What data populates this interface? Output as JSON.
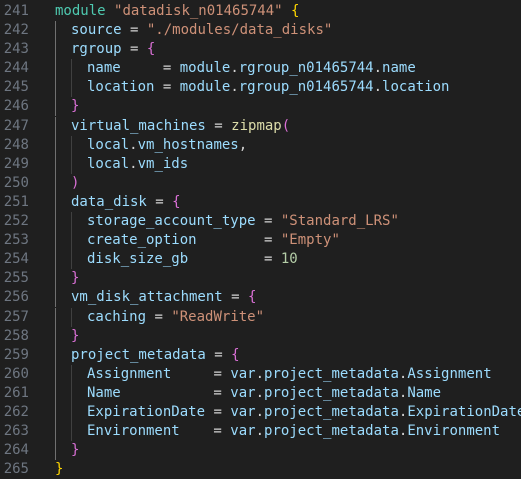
{
  "colors": {
    "background": "#1f1f1f",
    "line_number": "#6e7681",
    "keyword": "#4ec9b0",
    "string": "#ce9178",
    "identifier": "#9cdcfe",
    "operator": "#d4d4d4",
    "function": "#dcdcaa",
    "number": "#b5cea8",
    "bracket_level1": "#ffd700",
    "bracket_level2": "#da70d6"
  },
  "lines": [
    {
      "num": "241",
      "indent": 0,
      "tokens": [
        {
          "t": "module",
          "c": "kw"
        },
        {
          "t": " ",
          "c": "op"
        },
        {
          "t": "\"datadisk_n01465744\"",
          "c": "str"
        },
        {
          "t": " ",
          "c": "op"
        },
        {
          "t": "{",
          "c": "b1"
        }
      ]
    },
    {
      "num": "242",
      "indent": 1,
      "tokens": [
        {
          "t": "source",
          "c": "id"
        },
        {
          "t": " = ",
          "c": "op"
        },
        {
          "t": "\"./modules/data_disks\"",
          "c": "str"
        }
      ]
    },
    {
      "num": "243",
      "indent": 1,
      "tokens": [
        {
          "t": "rgroup",
          "c": "id"
        },
        {
          "t": " = ",
          "c": "op"
        },
        {
          "t": "{",
          "c": "b2"
        }
      ]
    },
    {
      "num": "244",
      "indent": 2,
      "tokens": [
        {
          "t": "name",
          "c": "id"
        },
        {
          "t": "     = ",
          "c": "op"
        },
        {
          "t": "module",
          "c": "id"
        },
        {
          "t": ".",
          "c": "op"
        },
        {
          "t": "rgroup_n01465744",
          "c": "id"
        },
        {
          "t": ".",
          "c": "op"
        },
        {
          "t": "name",
          "c": "id"
        }
      ]
    },
    {
      "num": "245",
      "indent": 2,
      "tokens": [
        {
          "t": "location",
          "c": "id"
        },
        {
          "t": " = ",
          "c": "op"
        },
        {
          "t": "module",
          "c": "id"
        },
        {
          "t": ".",
          "c": "op"
        },
        {
          "t": "rgroup_n01465744",
          "c": "id"
        },
        {
          "t": ".",
          "c": "op"
        },
        {
          "t": "location",
          "c": "id"
        }
      ]
    },
    {
      "num": "246",
      "indent": 1,
      "tokens": [
        {
          "t": "}",
          "c": "b2"
        }
      ]
    },
    {
      "num": "247",
      "indent": 1,
      "tokens": [
        {
          "t": "virtual_machines",
          "c": "id"
        },
        {
          "t": " = ",
          "c": "op"
        },
        {
          "t": "zipmap",
          "c": "fn"
        },
        {
          "t": "(",
          "c": "b2"
        }
      ]
    },
    {
      "num": "248",
      "indent": 2,
      "tokens": [
        {
          "t": "local",
          "c": "id"
        },
        {
          "t": ".",
          "c": "op"
        },
        {
          "t": "vm_hostnames",
          "c": "id"
        },
        {
          "t": ",",
          "c": "op"
        }
      ]
    },
    {
      "num": "249",
      "indent": 2,
      "tokens": [
        {
          "t": "local",
          "c": "id"
        },
        {
          "t": ".",
          "c": "op"
        },
        {
          "t": "vm_ids",
          "c": "id"
        }
      ]
    },
    {
      "num": "250",
      "indent": 1,
      "tokens": [
        {
          "t": ")",
          "c": "b2"
        }
      ]
    },
    {
      "num": "251",
      "indent": 1,
      "tokens": [
        {
          "t": "data_disk",
          "c": "id"
        },
        {
          "t": " = ",
          "c": "op"
        },
        {
          "t": "{",
          "c": "b2"
        }
      ]
    },
    {
      "num": "252",
      "indent": 2,
      "tokens": [
        {
          "t": "storage_account_type",
          "c": "id"
        },
        {
          "t": " = ",
          "c": "op"
        },
        {
          "t": "\"Standard_LRS\"",
          "c": "str"
        }
      ]
    },
    {
      "num": "253",
      "indent": 2,
      "tokens": [
        {
          "t": "create_option",
          "c": "id"
        },
        {
          "t": "        = ",
          "c": "op"
        },
        {
          "t": "\"Empty\"",
          "c": "str"
        }
      ]
    },
    {
      "num": "254",
      "indent": 2,
      "tokens": [
        {
          "t": "disk_size_gb",
          "c": "id"
        },
        {
          "t": "         = ",
          "c": "op"
        },
        {
          "t": "10",
          "c": "num"
        }
      ]
    },
    {
      "num": "255",
      "indent": 1,
      "tokens": [
        {
          "t": "}",
          "c": "b2"
        }
      ]
    },
    {
      "num": "256",
      "indent": 1,
      "tokens": [
        {
          "t": "vm_disk_attachment",
          "c": "id"
        },
        {
          "t": " = ",
          "c": "op"
        },
        {
          "t": "{",
          "c": "b2"
        }
      ]
    },
    {
      "num": "257",
      "indent": 2,
      "tokens": [
        {
          "t": "caching",
          "c": "id"
        },
        {
          "t": " = ",
          "c": "op"
        },
        {
          "t": "\"ReadWrite\"",
          "c": "str"
        }
      ]
    },
    {
      "num": "258",
      "indent": 1,
      "tokens": [
        {
          "t": "}",
          "c": "b2"
        }
      ]
    },
    {
      "num": "259",
      "indent": 1,
      "tokens": [
        {
          "t": "project_metadata",
          "c": "id"
        },
        {
          "t": " = ",
          "c": "op"
        },
        {
          "t": "{",
          "c": "b2"
        }
      ]
    },
    {
      "num": "260",
      "indent": 2,
      "tokens": [
        {
          "t": "Assignment",
          "c": "id"
        },
        {
          "t": "     = ",
          "c": "op"
        },
        {
          "t": "var",
          "c": "id"
        },
        {
          "t": ".",
          "c": "op"
        },
        {
          "t": "project_metadata",
          "c": "id"
        },
        {
          "t": ".",
          "c": "op"
        },
        {
          "t": "Assignment",
          "c": "id"
        }
      ]
    },
    {
      "num": "261",
      "indent": 2,
      "tokens": [
        {
          "t": "Name",
          "c": "id"
        },
        {
          "t": "           = ",
          "c": "op"
        },
        {
          "t": "var",
          "c": "id"
        },
        {
          "t": ".",
          "c": "op"
        },
        {
          "t": "project_metadata",
          "c": "id"
        },
        {
          "t": ".",
          "c": "op"
        },
        {
          "t": "Name",
          "c": "id"
        }
      ]
    },
    {
      "num": "262",
      "indent": 2,
      "tokens": [
        {
          "t": "ExpirationDate",
          "c": "id"
        },
        {
          "t": " = ",
          "c": "op"
        },
        {
          "t": "var",
          "c": "id"
        },
        {
          "t": ".",
          "c": "op"
        },
        {
          "t": "project_metadata",
          "c": "id"
        },
        {
          "t": ".",
          "c": "op"
        },
        {
          "t": "ExpirationDate",
          "c": "id"
        }
      ]
    },
    {
      "num": "263",
      "indent": 2,
      "tokens": [
        {
          "t": "Environment",
          "c": "id"
        },
        {
          "t": "    = ",
          "c": "op"
        },
        {
          "t": "var",
          "c": "id"
        },
        {
          "t": ".",
          "c": "op"
        },
        {
          "t": "project_metadata",
          "c": "id"
        },
        {
          "t": ".",
          "c": "op"
        },
        {
          "t": "Environment",
          "c": "id"
        }
      ]
    },
    {
      "num": "264",
      "indent": 1,
      "tokens": [
        {
          "t": "}",
          "c": "b2"
        }
      ]
    },
    {
      "num": "265",
      "indent": 0,
      "tokens": [
        {
          "t": "}",
          "c": "b1"
        }
      ]
    }
  ]
}
